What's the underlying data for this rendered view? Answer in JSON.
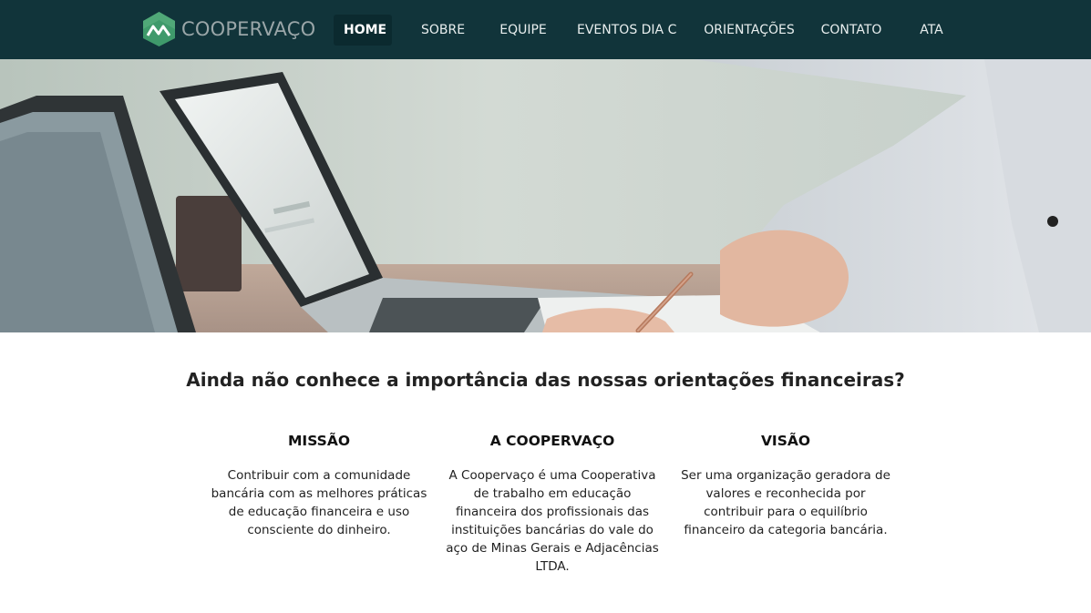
{
  "brand": {
    "name": "COOPERVAÇO",
    "logo_icon": "mountain-chart-icon"
  },
  "nav": {
    "items": [
      {
        "label": "HOME",
        "active": true
      },
      {
        "label": "SOBRE",
        "active": false
      },
      {
        "label": "EQUIPE",
        "active": false
      },
      {
        "label": "EVENTOS DIA C",
        "active": false
      },
      {
        "label": "ORIENTAÇÕES",
        "active": false
      },
      {
        "label": "CONTATO",
        "active": false
      },
      {
        "label": "ATA",
        "active": false
      }
    ]
  },
  "hero": {
    "description": "laptops-and-hand-with-pen-photo"
  },
  "content": {
    "headline": "Ainda não conhece a importância das nossas orientações financeiras?",
    "columns": [
      {
        "title": "MISSÃO",
        "text": "Contribuir com a comunidade bancária com as melhores práticas de educação financeira e uso consciente do dinheiro."
      },
      {
        "title": "A COOPERVAÇO",
        "text": "A Coopervaço é uma Cooperativa de trabalho em educação financeira dos profissionais das instituições bancárias do vale do aço de Minas Gerais e Adjacências LTDA."
      },
      {
        "title": "VISÃO",
        "text": "Ser uma organização geradora de valores e reconhecida por contribuir para o equilíbrio financeiro da categoria bancária."
      }
    ]
  },
  "colors": {
    "navbar": "#11343a",
    "nav_active": "#0b2a2f",
    "logo_green": "#3f9a6b"
  }
}
